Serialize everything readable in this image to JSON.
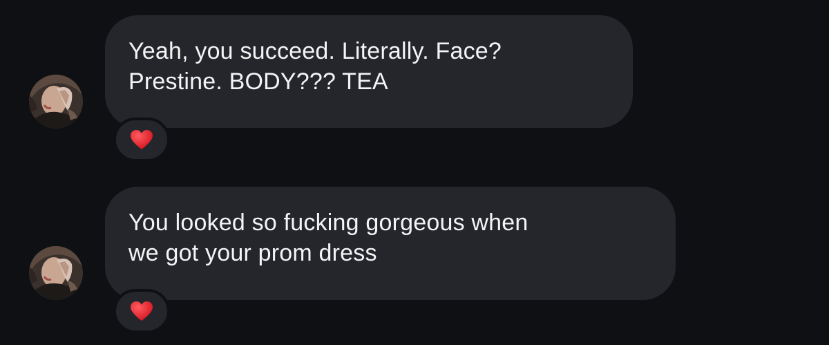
{
  "messages": [
    {
      "sender_avatar": "profile-photo",
      "lines": [
        "Yeah, you succeed. Literally. Face?",
        "Prestine. BODY??? TEA"
      ],
      "reaction": "red-heart-icon"
    },
    {
      "sender_avatar": "profile-photo",
      "lines": [
        "You looked so fucking gorgeous when",
        "we got your prom dress"
      ],
      "reaction": "red-heart-icon"
    }
  ],
  "colors": {
    "background": "#0f1014",
    "bubble": "#25262b",
    "text": "#f4f4f6",
    "heart": "#e0242e"
  }
}
